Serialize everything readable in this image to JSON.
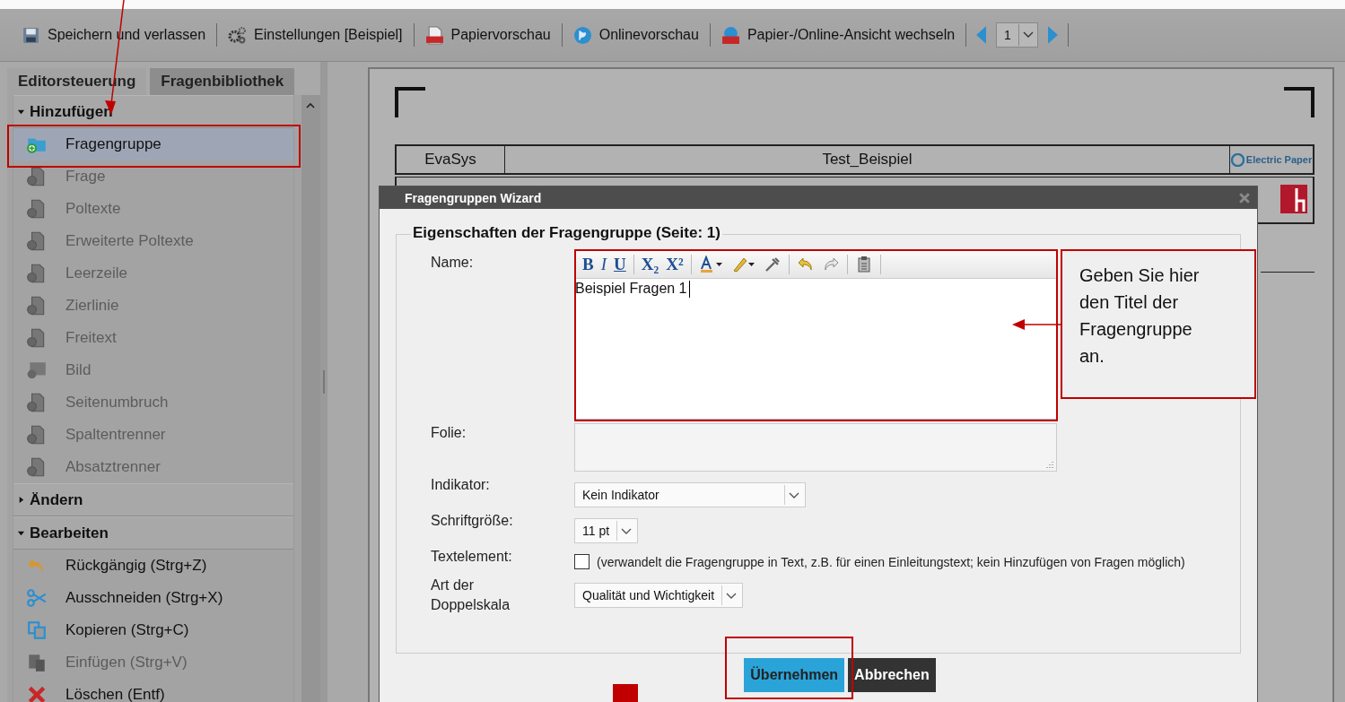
{
  "toolbar": {
    "items": [
      {
        "label": "Speichern und verlassen"
      },
      {
        "label": "Einstellungen [Beispiel]"
      },
      {
        "label": "Papiervorschau"
      },
      {
        "label": "Onlinevorschau"
      },
      {
        "label": "Papier-/Online-Ansicht wechseln"
      }
    ],
    "page_select": {
      "value": "1"
    }
  },
  "sidebar": {
    "tabs": [
      {
        "label": "Editorsteuerung",
        "selected": true
      },
      {
        "label": "Fragenbibliothek",
        "selected": false
      }
    ],
    "sections": [
      {
        "title": "Hinzufügen",
        "expanded": true,
        "items": [
          {
            "label": "Fragengruppe",
            "disabled": false,
            "selected": true
          },
          {
            "label": "Frage",
            "disabled": true,
            "selected": false
          },
          {
            "label": "Poltexte",
            "disabled": true,
            "selected": false
          },
          {
            "label": "Erweiterte Poltexte",
            "disabled": true,
            "selected": false
          },
          {
            "label": "Leerzeile",
            "disabled": true,
            "selected": false
          },
          {
            "label": "Zierlinie",
            "disabled": true,
            "selected": false
          },
          {
            "label": "Freitext",
            "disabled": true,
            "selected": false
          },
          {
            "label": "Bild",
            "disabled": true,
            "selected": false
          },
          {
            "label": "Seitenumbruch",
            "disabled": true,
            "selected": false
          },
          {
            "label": "Spaltentrenner",
            "disabled": true,
            "selected": false
          },
          {
            "label": "Absatztrenner",
            "disabled": true,
            "selected": false
          }
        ]
      },
      {
        "title": "Ändern",
        "expanded": false
      },
      {
        "title": "Bearbeiten",
        "expanded": true,
        "items": [
          {
            "label": "Rückgängig (Strg+Z)",
            "disabled": false,
            "selected": false
          },
          {
            "label": "Ausschneiden (Strg+X)",
            "disabled": false,
            "selected": false
          },
          {
            "label": "Kopieren (Strg+C)",
            "disabled": false,
            "selected": false
          },
          {
            "label": "Einfügen (Strg+V)",
            "disabled": true,
            "selected": false
          },
          {
            "label": "Löschen (Entf)",
            "disabled": false,
            "selected": false
          }
        ]
      }
    ]
  },
  "document": {
    "header": [
      "EvaSys",
      "Test_Beispiel"
    ],
    "logo": "Electric Paper"
  },
  "dialog": {
    "title": "Fragengruppen Wizard",
    "legend": "Eigenschaften der Fragengruppe (Seite: 1)",
    "name_label": "Name:",
    "format_buttons": [
      "B",
      "I",
      "U",
      "X₂",
      "X²"
    ],
    "name_value": "Beispiel Fragen 1",
    "folie_label": "Folie:",
    "indikator_label": "Indikator:",
    "indikator_value": "Kein Indikator",
    "schrift_label": "Schriftgröße:",
    "schrift_value": "11 pt",
    "textelement_label": "Textelement:",
    "textelement_checked": false,
    "textelement_hint": "(verwandelt die Fragengruppe in Text, z.B. für einen Einleitungstext; kein Hinzufügen von Fragen möglich)",
    "art_label": "Art der Doppelskala",
    "art_value": "Qualität und Wichtigkeit",
    "buttons": [
      "Übernehmen",
      "Abbrechen"
    ]
  },
  "callout": {
    "text": "Geben Sie hier den Titel der Fragengruppe an."
  }
}
